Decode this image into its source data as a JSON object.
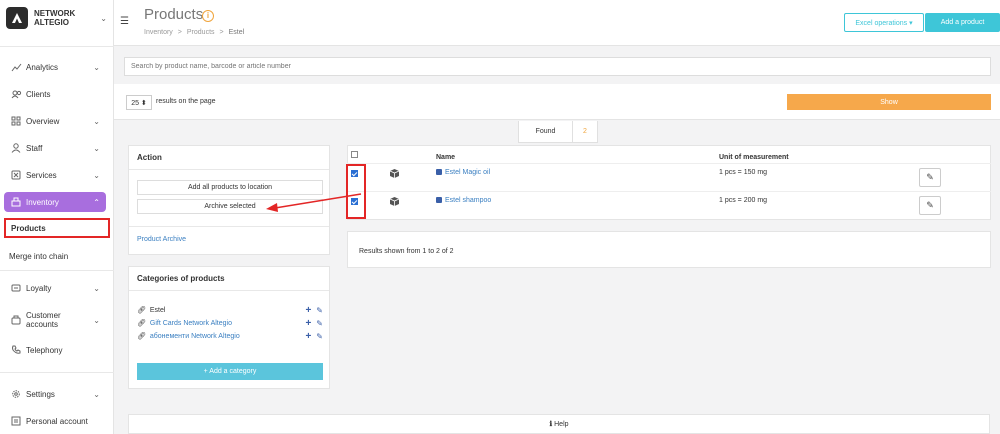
{
  "brand": {
    "name_line1": "NETWORK",
    "name_line2": "ALTEGIO"
  },
  "sidebar": {
    "items": [
      {
        "label": "Analytics",
        "icon": "analytics-icon"
      },
      {
        "label": "Clients",
        "icon": "clients-icon"
      },
      {
        "label": "Overview",
        "icon": "overview-icon"
      },
      {
        "label": "Staff",
        "icon": "staff-icon"
      },
      {
        "label": "Services",
        "icon": "services-icon"
      },
      {
        "label": "Inventory",
        "icon": "inventory-icon"
      },
      {
        "label": "Products"
      },
      {
        "label": "Merge into chain"
      },
      {
        "label": "Loyalty",
        "icon": "loyalty-icon"
      },
      {
        "label": "Customer accounts",
        "icon": "customer-accounts-icon"
      },
      {
        "label": "Telephony",
        "icon": "telephony-icon"
      },
      {
        "label": "Settings",
        "icon": "settings-icon"
      },
      {
        "label": "Personal account",
        "icon": "personal-account-icon"
      }
    ]
  },
  "header": {
    "title": "Products",
    "breadcrumb": [
      "Inventory",
      ">",
      "Products",
      ">",
      "Estel"
    ],
    "excel_label": "Excel operations ▾",
    "add_label": "Add a product"
  },
  "filters": {
    "search_placeholder": "Search by product name, barcode or article number",
    "per_page": "25 ⬍",
    "per_page_label": "results on the page",
    "show_label": "Show"
  },
  "found": {
    "label": "Found",
    "count": "2"
  },
  "action_panel": {
    "title": "Action",
    "add_all_label": "Add all products to location",
    "archive_label": "Archive selected",
    "archive_link": "Product Archive"
  },
  "categories_panel": {
    "title": "Categories of products",
    "items": [
      "Estel",
      "Gift Cards Network Altegio",
      "абонементи Network Altegio"
    ],
    "add_label": "+ Add a category"
  },
  "table": {
    "headers": {
      "name": "Name",
      "unit": "Unit of measurement"
    },
    "rows": [
      {
        "name": "Estel Magic oil",
        "unit": "1 pcs = 150 mg",
        "checked": true
      },
      {
        "name": "Estel shampoo",
        "unit": "1 pcs = 200 mg",
        "checked": true
      }
    ],
    "results_text": "Results shown from 1 to 2 of 2"
  },
  "help_label": "Help",
  "colors": {
    "accent": "#a86ede",
    "cyan": "#3ec6d8",
    "orange": "#f6a84b",
    "annotation": "#e32626"
  }
}
